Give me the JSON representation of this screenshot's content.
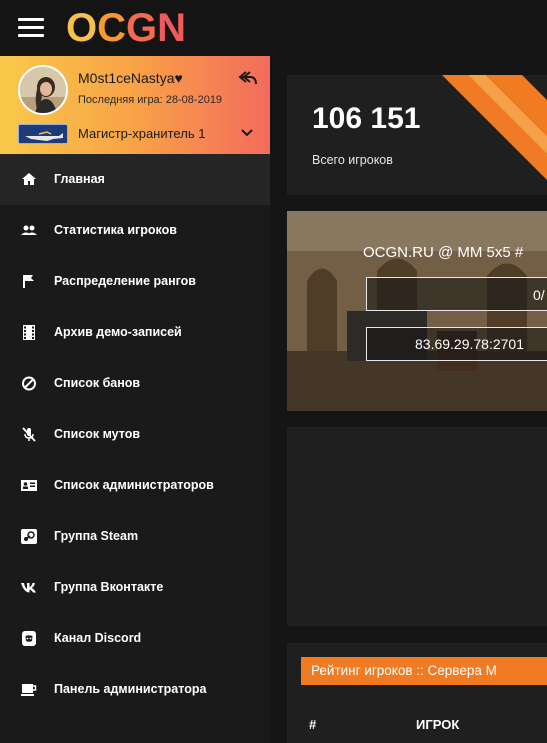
{
  "header": {
    "logo": {
      "o": "O",
      "c": "C",
      "g": "G",
      "n": "N"
    }
  },
  "user": {
    "name": "M0st1ceNastya♥",
    "last_game": "Последняя игра: 28-08-2019",
    "rank": "Магистр-хранитель 1"
  },
  "sidebar": {
    "items": [
      {
        "label": "Главная",
        "icon": "home-icon"
      },
      {
        "label": "Статистика игроков",
        "icon": "users-icon"
      },
      {
        "label": "Распределение рангов",
        "icon": "flag-icon"
      },
      {
        "label": "Архив демо-записей",
        "icon": "film-icon"
      },
      {
        "label": "Список банов",
        "icon": "ban-icon"
      },
      {
        "label": "Список мутов",
        "icon": "mic-off-icon"
      },
      {
        "label": "Список администраторов",
        "icon": "admin-list-icon"
      },
      {
        "label": "Группа Steam",
        "icon": "steam-icon"
      },
      {
        "label": "Группа Вконтакте",
        "icon": "vk-icon"
      },
      {
        "label": "Канал Discord",
        "icon": "discord-icon"
      },
      {
        "label": "Панель администратора",
        "icon": "coffee-icon"
      }
    ]
  },
  "stats": {
    "total_players": "106 151",
    "total_players_label": "Всего игроков"
  },
  "server": {
    "name": "OCGN.RU @ MM 5x5 #",
    "players": "0/",
    "ip": "83.69.29.78:2701"
  },
  "rating": {
    "title": "Рейтинг игроков :: Сервера М",
    "columns": {
      "hash": "#",
      "player": "ИГРОК"
    }
  },
  "colors": {
    "accent": "#f07b22",
    "background": "#151515",
    "sidebar": "#1a1a1a",
    "card": "#1f1f1f"
  }
}
